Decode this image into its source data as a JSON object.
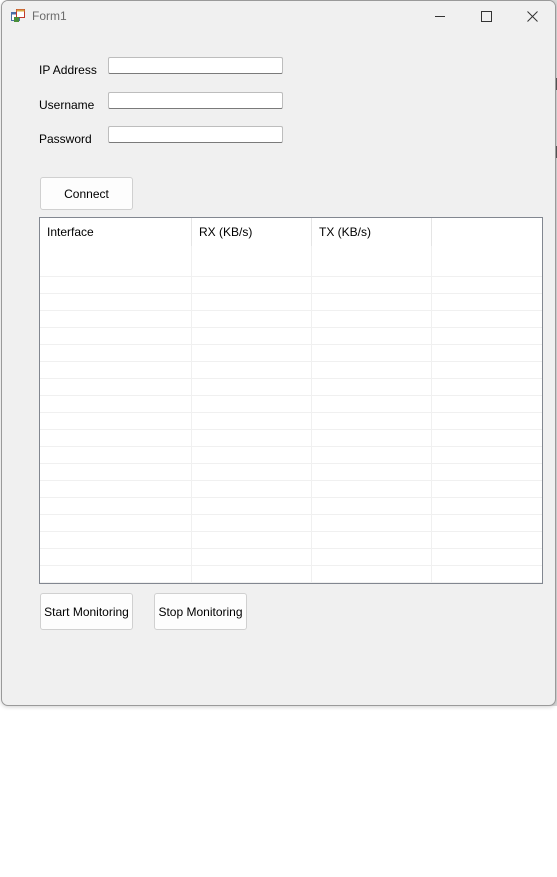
{
  "window": {
    "title": "Form1",
    "icons": {
      "app": "app-form-icon",
      "minimize": "minimize-icon",
      "maximize": "maximize-icon",
      "close": "close-icon"
    }
  },
  "form": {
    "ip_label": "IP Address",
    "ip_value": "",
    "username_label": "Username",
    "username_value": "",
    "password_label": "Password",
    "password_value": "",
    "connect_label": "Connect"
  },
  "table": {
    "columns": [
      "Interface",
      "RX (KB/s)",
      "TX (KB/s)",
      ""
    ],
    "rows": []
  },
  "actions": {
    "start_label": "Start Monitoring",
    "stop_label": "Stop Monitoring"
  },
  "colors": {
    "window_bg": "#f0f0f0",
    "border": "#828790"
  }
}
